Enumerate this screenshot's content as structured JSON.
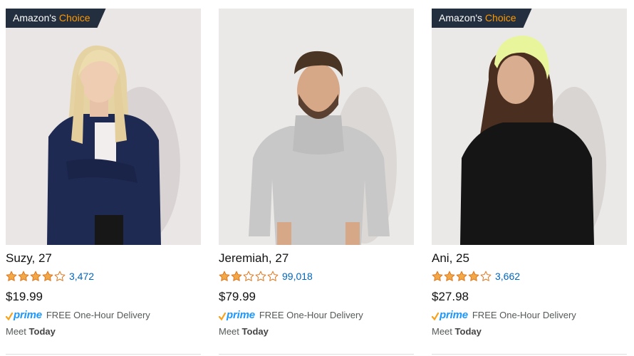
{
  "badge": {
    "prefix": "Amazon's",
    "suffix": "Choice"
  },
  "prime_label": "prime",
  "colors": {
    "badge_bg": "#232f3e",
    "choice_orange": "#ff9900",
    "star_gold": "#f3a847",
    "link_blue": "#0066c0",
    "prime_blue": "#1a98ff"
  },
  "products": [
    {
      "amazons_choice": true,
      "name": "Suzy, 27",
      "rating": 4,
      "reviews": "3,472",
      "price": "$19.99",
      "delivery": "FREE One-Hour Delivery",
      "meet_prefix": "Meet",
      "meet_when": "Today"
    },
    {
      "amazons_choice": false,
      "name": "Jeremiah, 27",
      "rating": 2,
      "reviews": "99,018",
      "price": "$79.99",
      "delivery": "FREE One-Hour Delivery",
      "meet_prefix": "Meet",
      "meet_when": "Today"
    },
    {
      "amazons_choice": true,
      "name": "Ani, 25",
      "rating": 4,
      "reviews": "3,662",
      "price": "$27.98",
      "delivery": "FREE One-Hour Delivery",
      "meet_prefix": "Meet",
      "meet_when": "Today"
    }
  ]
}
